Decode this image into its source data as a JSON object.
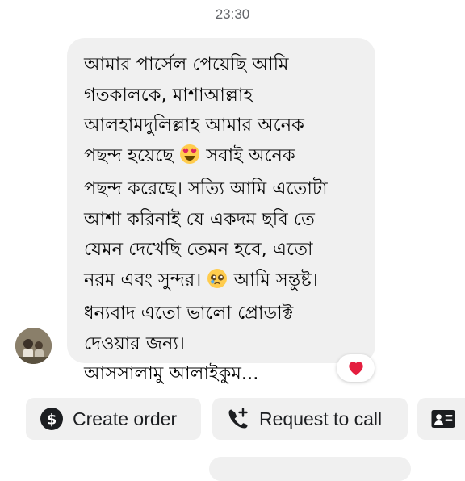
{
  "timestamp": "23:30",
  "message": {
    "lines": [
      "আমার পার্সেল পেয়েছি আমি",
      "গতকালকে,  মাশাআল্লাহ",
      "আলহামদুলিল্লাহ আমার অনেক",
      "পছন্দ হয়েছে",
      "সবাই অনেক",
      "পছন্দ করেছে। সত্যি আমি এতোটা",
      "আশা করিনাই যে একদম ছবি তে",
      "যেমন দেখেছি তেমন হবে, এতো",
      "নরম এবং সুন্দর।",
      "আমি সন্তুষ্ট।",
      "ধন্যবাদ এতো ভালো প্রোডাক্ট",
      "দেওয়ার জন্য।",
      "আসসালামু আলাইকুম..."
    ],
    "emojis": [
      "heart-eyes-emoji",
      "pleading-face-emoji"
    ]
  },
  "reaction": {
    "icon": "red-heart-icon",
    "color": "#e41e3f"
  },
  "actions": {
    "create_order": {
      "label": "Create order",
      "icon": "dollar-circle-icon"
    },
    "request_call": {
      "label": "Request to call",
      "icon": "phone-add-icon"
    },
    "contact": {
      "icon": "contact-card-icon"
    }
  },
  "colors": {
    "bubble_bg": "#f0f0f0",
    "text": "#050505",
    "timestamp": "#65676b",
    "button_bg": "#f0f0f0"
  }
}
